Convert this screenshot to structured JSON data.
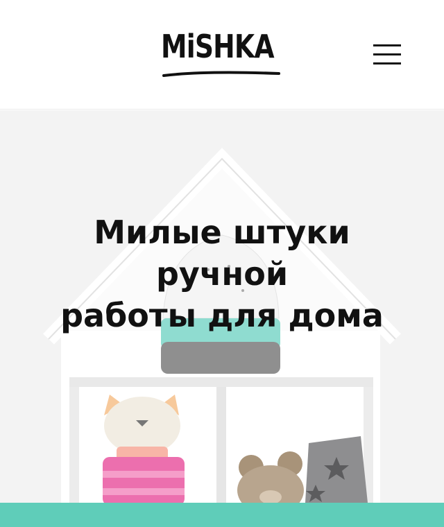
{
  "header": {
    "logo_text": "MiSHKA",
    "menu_icon": "hamburger-menu-icon"
  },
  "hero": {
    "title_lines": [
      "Милые штуки",
      "ручной",
      "работы для дома"
    ]
  },
  "colors": {
    "accent": "#5fcdb9",
    "text": "#111111",
    "hero_bg": "#f3f3f3"
  }
}
